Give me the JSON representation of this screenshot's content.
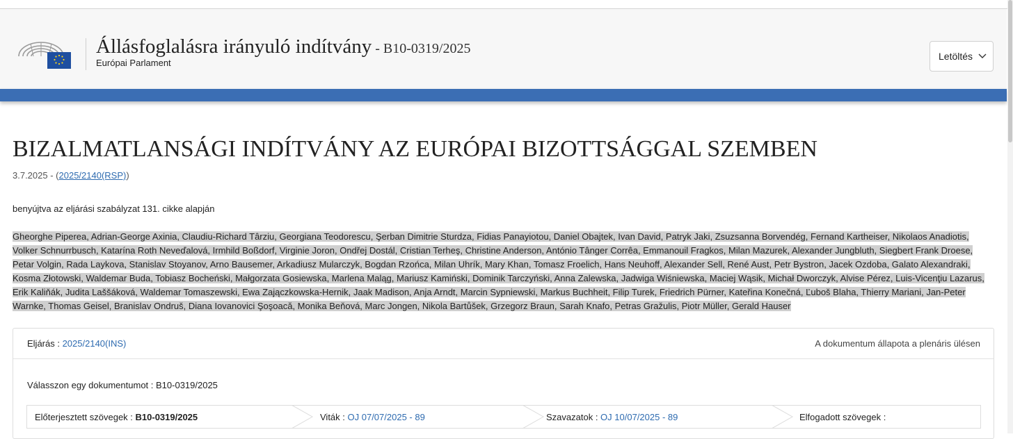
{
  "header": {
    "title": "Állásfoglalásra irányuló indítvány",
    "ref": " - B10-0319/2025",
    "subtitle": "Európai Parlament",
    "download_label": "Letöltés",
    "logo_icon": "european-parliament-logo",
    "chevron_icon": "chevron-down-icon"
  },
  "document": {
    "title": "BIZALMATLANSÁGI INDÍTVÁNY AZ EURÓPAI BIZOTTSÁGGAL SZEMBEN",
    "date": "3.7.2025",
    "date_sep": " - (",
    "procedure_link": "2025/2140(RSP)",
    "date_close": ")",
    "basis": "benyújtva az eljárási szabályzat 131. cikke alapján",
    "authors": "Gheorghe Piperea, Adrian-George Axinia, Claudiu-Richard Târziu, Georgiana Teodorescu, Şerban Dimitrie Sturdza, Fidias Panayiotou, Daniel Obajtek, Ivan David, Patryk Jaki, Zsuzsanna Borvendég, Fernand Kartheiser, Nikolaos Anadiotis, Volker Schnurrbusch, Katarína Roth Neveďalová, Irmhild Boßdorf, Virginie Joron, Ondřej Dostál, Cristian Terheş, Christine Anderson, António Tânger Corrêa, Emmanouil Fragkos, Milan Mazurek, Alexander Jungbluth, Siegbert Frank Droese, Petar Volgin, Rada Laykova, Stanislav Stoyanov, Arno Bausemer, Arkadiusz Mularczyk, Bogdan Rzońca, Milan Uhrík, Mary Khan, Tomasz Froelich, Hans Neuhoff, Alexander Sell, René Aust, Petr Bystron, Jacek Ozdoba, Galato Alexandraki, Kosma Złotowski, Waldemar Buda, Tobiasz Bocheński, Małgorzata Gosiewska, Marlena Maląg, Mariusz Kamiński, Dominik Tarczyński, Anna Zalewska, Jadwiga Wiśniewska, Maciej Wąsik, Michał Dworczyk, Alvise Pérez, Luis-Vicenţiu Lazarus, Erik Kaliňák, Judita Laššáková, Waldemar Tomaszewski, Ewa Zajączkowska-Hernik, Jaak Madison, Anja Arndt, Marcin Sypniewski, Markus Buchheit, Filip Turek, Friedrich Pürner, Kateřina Konečná, Ľuboš Blaha, Thierry Mariani, Jan-Peter Warnke, Thomas Geisel, Branislav Ondruš, Diana Iovanovici Şoşoacă, Monika Beňová, Marc Jongen, Nikola Bartůšek, Grzegorz Braun, Sarah Knafo, Petras Gražulis, Piotr Müller, Gerald Hauser"
  },
  "panel": {
    "procedure_label": "Eljárás : ",
    "procedure_value": "2025/2140(INS)",
    "status_label": "A dokumentum állapota a plenáris ülésen",
    "choose_label": "Válasszon egy dokumentumot : ",
    "choose_value": "B10-0319/2025",
    "steps": [
      {
        "label": "Előterjesztett szövegek : ",
        "value": "B10-0319/2025"
      },
      {
        "label": "Viták : ",
        "value": "OJ 07/07/2025 - 89"
      },
      {
        "label": "Szavazatok : ",
        "value": "OJ 10/07/2025 - 89"
      },
      {
        "label": "Elfogadott szövegek : ",
        "value": ""
      }
    ]
  }
}
